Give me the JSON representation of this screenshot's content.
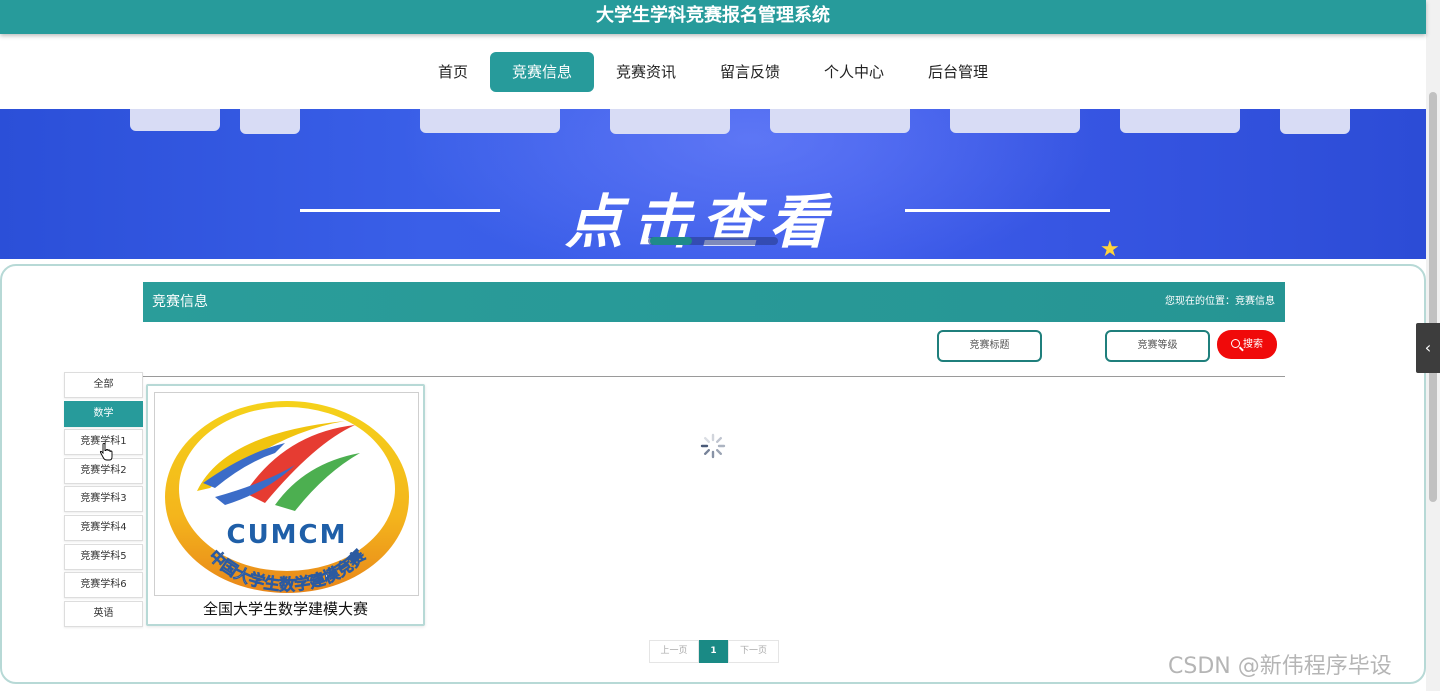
{
  "header": {
    "title": "大学生学科竞赛报名管理系统"
  },
  "nav": {
    "items": [
      {
        "label": "首页"
      },
      {
        "label": "竞赛信息",
        "active": true
      },
      {
        "label": "竞赛资讯"
      },
      {
        "label": "留言反馈"
      },
      {
        "label": "个人中心"
      },
      {
        "label": "后台管理"
      }
    ]
  },
  "banner": {
    "cta_text": "点击查看"
  },
  "section": {
    "title": "竞赛信息",
    "location": "您现在的位置：竞赛信息"
  },
  "filters": {
    "title_button": "竞赛标题",
    "level_button": "竞赛等级",
    "search_button": "搜索"
  },
  "categories": [
    {
      "label": "全部"
    },
    {
      "label": "数学",
      "active": true
    },
    {
      "label": "竞赛学科1"
    },
    {
      "label": "竞赛学科2"
    },
    {
      "label": "竞赛学科3"
    },
    {
      "label": "竞赛学科4"
    },
    {
      "label": "竞赛学科5"
    },
    {
      "label": "竞赛学科6"
    },
    {
      "label": "英语"
    }
  ],
  "competitions": [
    {
      "title": "全国大学生数学建模大赛",
      "logo_text": "CUMCM",
      "logo_ring_text": "中国大学生数学建模竞赛"
    }
  ],
  "pagination": {
    "prev": "上一页",
    "current": "1",
    "next": "下一页"
  },
  "watermark": "CSDN @新伟程序毕设",
  "colors": {
    "primary": "#279b9b",
    "search": "#f00a0a"
  }
}
